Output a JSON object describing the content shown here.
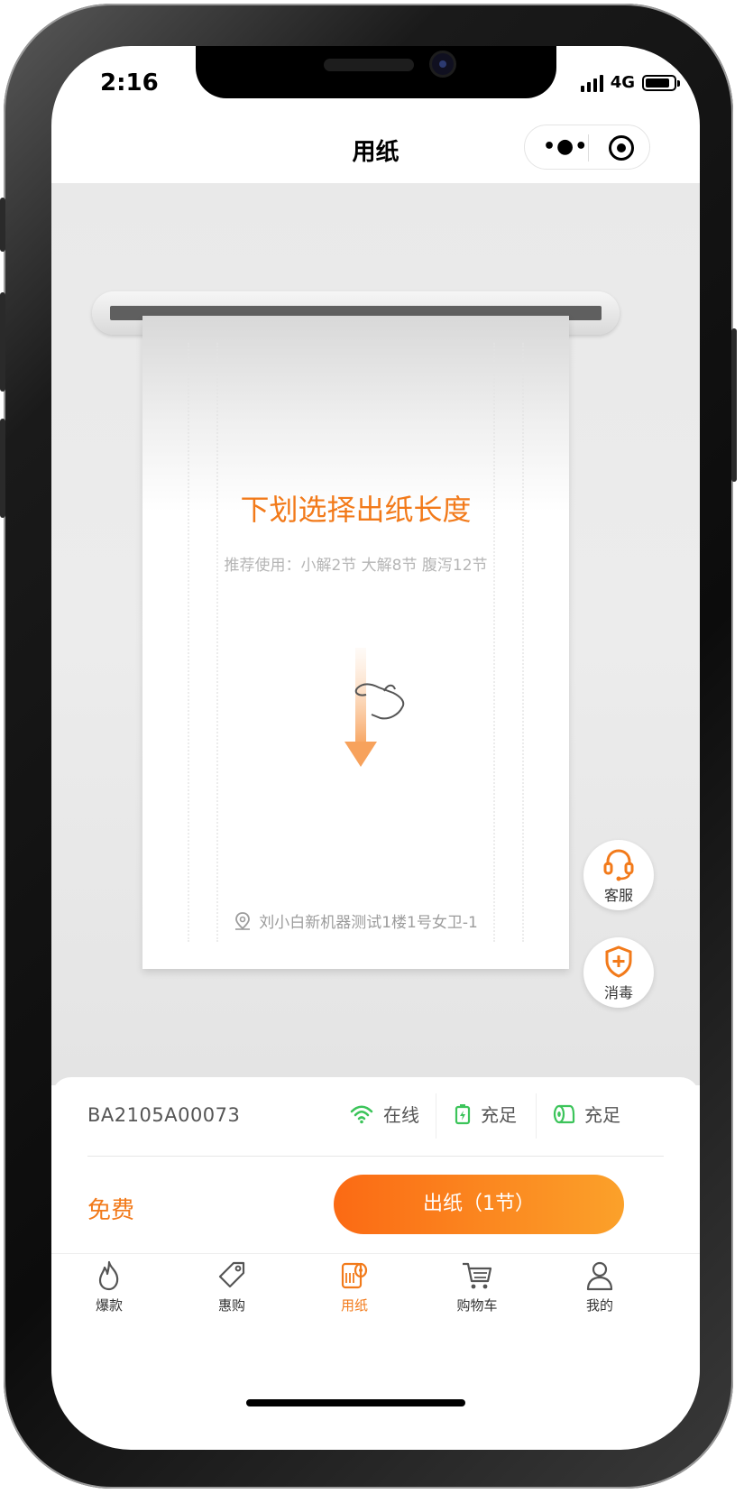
{
  "status_bar": {
    "time": "2:16",
    "network": "4G"
  },
  "nav": {
    "title": "用纸",
    "more_icon": "more-dots-icon",
    "close_icon": "target-circle-icon"
  },
  "paper": {
    "title": "下划选择出纸长度",
    "tip": "推荐使用：小解2节 大解8节 腹泻12节",
    "location": "刘小白新机器测试1楼1号女卫-1",
    "accent": "#f27a1a"
  },
  "float_buttons": [
    {
      "label": "客服",
      "icon": "headset-icon"
    },
    {
      "label": "消毒",
      "icon": "shield-plus-icon"
    }
  ],
  "panel": {
    "device_id": "BA2105A00073",
    "status": [
      {
        "icon": "wifi-icon",
        "label": "在线"
      },
      {
        "icon": "battery-icon",
        "label": "充足"
      },
      {
        "icon": "paper-roll-icon",
        "label": "充足"
      }
    ],
    "price": "免费",
    "dispense_button": "出纸（1节）"
  },
  "tabs": [
    {
      "label": "爆款",
      "icon": "flame-icon",
      "active": false
    },
    {
      "label": "惠购",
      "icon": "tag-icon",
      "active": false
    },
    {
      "label": "用纸",
      "icon": "paper-roll-icon",
      "active": true
    },
    {
      "label": "购物车",
      "icon": "cart-icon",
      "active": false
    },
    {
      "label": "我的",
      "icon": "user-icon",
      "active": false
    }
  ]
}
